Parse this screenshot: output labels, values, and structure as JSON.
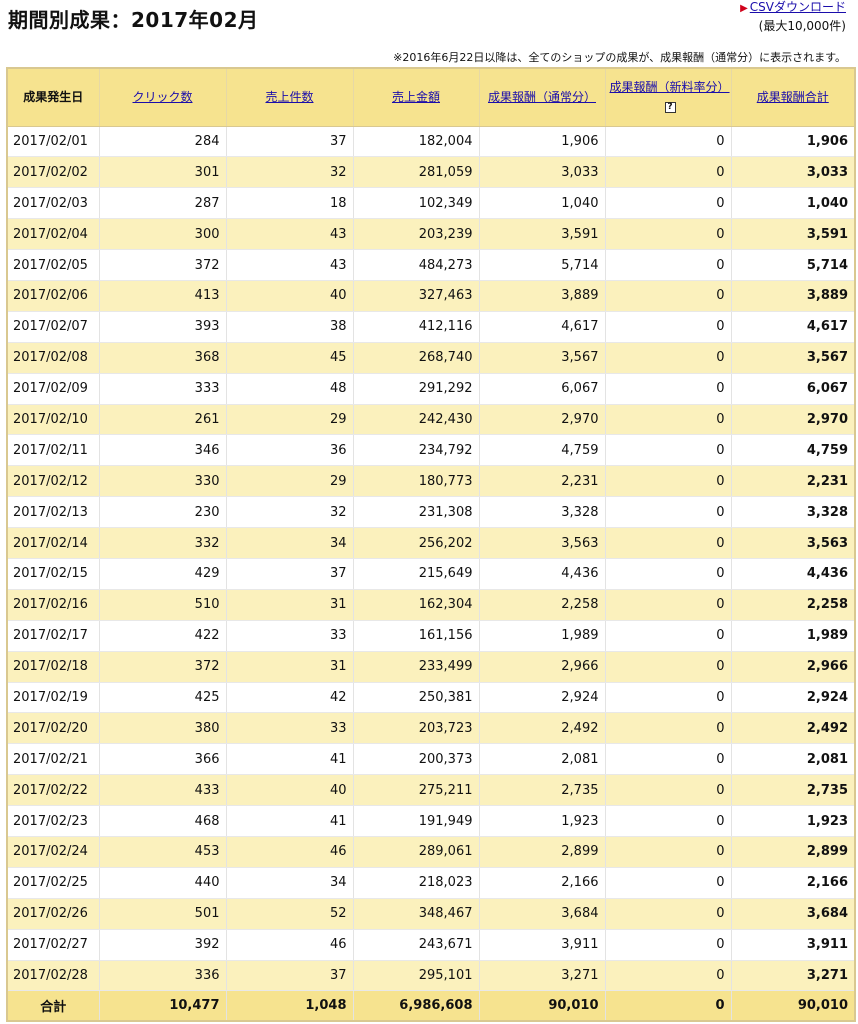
{
  "title": "期間別成果：2017年02月",
  "csv": {
    "link_label": "CSVダウンロード",
    "limit": "(最大10,000件)"
  },
  "notice": "※2016年6月22日以降は、全てのショップの成果が、成果報酬（通常分）に表示されます。",
  "columns": {
    "date": "成果発生日",
    "clicks": "クリック数",
    "sales_count": "売上件数",
    "sales_amount": "売上金額",
    "reward_normal": "成果報酬（通常分）",
    "reward_new_rate": "成果報酬（新料率分）",
    "reward_total": "成果報酬合計",
    "help": "?"
  },
  "rows": [
    [
      "2017/02/01",
      "284",
      "37",
      "182,004",
      "1,906",
      "0",
      "1,906"
    ],
    [
      "2017/02/02",
      "301",
      "32",
      "281,059",
      "3,033",
      "0",
      "3,033"
    ],
    [
      "2017/02/03",
      "287",
      "18",
      "102,349",
      "1,040",
      "0",
      "1,040"
    ],
    [
      "2017/02/04",
      "300",
      "43",
      "203,239",
      "3,591",
      "0",
      "3,591"
    ],
    [
      "2017/02/05",
      "372",
      "43",
      "484,273",
      "5,714",
      "0",
      "5,714"
    ],
    [
      "2017/02/06",
      "413",
      "40",
      "327,463",
      "3,889",
      "0",
      "3,889"
    ],
    [
      "2017/02/07",
      "393",
      "38",
      "412,116",
      "4,617",
      "0",
      "4,617"
    ],
    [
      "2017/02/08",
      "368",
      "45",
      "268,740",
      "3,567",
      "0",
      "3,567"
    ],
    [
      "2017/02/09",
      "333",
      "48",
      "291,292",
      "6,067",
      "0",
      "6,067"
    ],
    [
      "2017/02/10",
      "261",
      "29",
      "242,430",
      "2,970",
      "0",
      "2,970"
    ],
    [
      "2017/02/11",
      "346",
      "36",
      "234,792",
      "4,759",
      "0",
      "4,759"
    ],
    [
      "2017/02/12",
      "330",
      "29",
      "180,773",
      "2,231",
      "0",
      "2,231"
    ],
    [
      "2017/02/13",
      "230",
      "32",
      "231,308",
      "3,328",
      "0",
      "3,328"
    ],
    [
      "2017/02/14",
      "332",
      "34",
      "256,202",
      "3,563",
      "0",
      "3,563"
    ],
    [
      "2017/02/15",
      "429",
      "37",
      "215,649",
      "4,436",
      "0",
      "4,436"
    ],
    [
      "2017/02/16",
      "510",
      "31",
      "162,304",
      "2,258",
      "0",
      "2,258"
    ],
    [
      "2017/02/17",
      "422",
      "33",
      "161,156",
      "1,989",
      "0",
      "1,989"
    ],
    [
      "2017/02/18",
      "372",
      "31",
      "233,499",
      "2,966",
      "0",
      "2,966"
    ],
    [
      "2017/02/19",
      "425",
      "42",
      "250,381",
      "2,924",
      "0",
      "2,924"
    ],
    [
      "2017/02/20",
      "380",
      "33",
      "203,723",
      "2,492",
      "0",
      "2,492"
    ],
    [
      "2017/02/21",
      "366",
      "41",
      "200,373",
      "2,081",
      "0",
      "2,081"
    ],
    [
      "2017/02/22",
      "433",
      "40",
      "275,211",
      "2,735",
      "0",
      "2,735"
    ],
    [
      "2017/02/23",
      "468",
      "41",
      "191,949",
      "1,923",
      "0",
      "1,923"
    ],
    [
      "2017/02/24",
      "453",
      "46",
      "289,061",
      "2,899",
      "0",
      "2,899"
    ],
    [
      "2017/02/25",
      "440",
      "34",
      "218,023",
      "2,166",
      "0",
      "2,166"
    ],
    [
      "2017/02/26",
      "501",
      "52",
      "348,467",
      "3,684",
      "0",
      "3,684"
    ],
    [
      "2017/02/27",
      "392",
      "46",
      "243,671",
      "3,911",
      "0",
      "3,911"
    ],
    [
      "2017/02/28",
      "336",
      "37",
      "295,101",
      "3,271",
      "0",
      "3,271"
    ]
  ],
  "total": [
    "合計",
    "10,477",
    "1,048",
    "6,986,608",
    "90,010",
    "0",
    "90,010"
  ],
  "colors": {
    "header_bg": "#f6e38f",
    "row_alt_bg": "#fbf1bd",
    "link": "#1a0dab",
    "arrow": "#d0021b"
  }
}
